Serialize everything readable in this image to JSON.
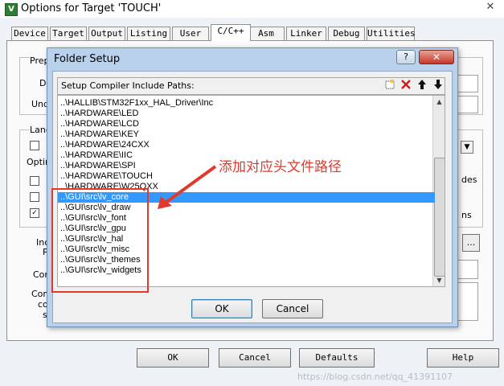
{
  "window": {
    "title": "Options for Target 'TOUCH'",
    "icon_text": "V",
    "close_glyph": "✕"
  },
  "tabs": [
    "Device",
    "Target",
    "Output",
    "Listing",
    "User",
    "C/C++",
    "Asm",
    "Linker",
    "Debug",
    "Utilities"
  ],
  "background": {
    "prep_label": "Prep",
    "d_label": "D",
    "und_label": "Undi",
    "lang_label": "Lang",
    "optim_label": "Optim",
    "side_text_1": "des",
    "side_text_2": "ns",
    "incl_label": "Inc",
    "p_label": "P",
    "con_label": "Con",
    "comp_label": "Com",
    "co_label": "co",
    "s_label": "s",
    "browse_label": "..."
  },
  "bottom_buttons": {
    "ok": "OK",
    "cancel": "Cancel",
    "defaults": "Defaults",
    "help": "Help"
  },
  "dialog": {
    "title": "Folder Setup",
    "help_glyph": "?",
    "close_glyph": "✕",
    "section_label": "Setup Compiler Include Paths:",
    "toolbar_icons": [
      "new-folder-icon",
      "delete-icon",
      "move-up-icon",
      "move-down-icon"
    ],
    "paths": [
      "..\\HALLIB\\STM32F1xx_HAL_Driver\\Inc",
      "..\\HARDWARE\\LED",
      "..\\HARDWARE\\LCD",
      "..\\HARDWARE\\KEY",
      "..\\HARDWARE\\24CXX",
      "..\\HARDWARE\\IIC",
      "..\\HARDWARE\\SPI",
      "..\\HARDWARE\\TOUCH",
      "..\\HARDWARE\\W25QXX",
      "..\\GUI\\src\\lv_core",
      "..\\GUI\\src\\lv_draw",
      "..\\GUI\\src\\lv_font",
      "..\\GUI\\src\\lv_gpu",
      "..\\GUI\\src\\lv_hal",
      "..\\GUI\\src\\lv_misc",
      "..\\GUI\\src\\lv_themes",
      "..\\GUI\\src\\lv_widgets"
    ],
    "selected_index": 9,
    "ok_label": "OK",
    "cancel_label": "Cancel"
  },
  "annotation": {
    "text": "添加对应头文件路径",
    "color": "#e3382c"
  },
  "watermark": "https://blog.csdn.net/qq_41391107",
  "colors": {
    "selection": "#3399ff",
    "annotation": "#e3382c",
    "dialog_frame": "#b9d1ea"
  }
}
